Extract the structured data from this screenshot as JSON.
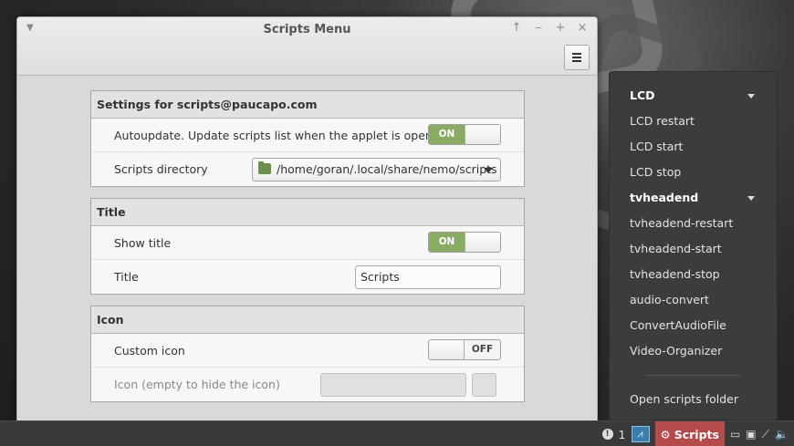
{
  "window": {
    "title": "Scripts Menu",
    "controls": {
      "up": "↑",
      "minimize": "–",
      "maximize": "+",
      "close": "×"
    }
  },
  "sections": {
    "settings": {
      "heading": "Settings for scripts@paucapo.com",
      "autoupdate_label": "Autoupdate. Update scripts list when the applet is opened.",
      "autoupdate_state": "ON",
      "scripts_dir_label": "Scripts directory",
      "scripts_dir_value": "/home/goran/.local/share/nemo/scripts"
    },
    "title": {
      "heading": "Title",
      "show_title_label": "Show title",
      "show_title_state": "ON",
      "title_label": "Title",
      "title_value": "Scripts"
    },
    "icon": {
      "heading": "Icon",
      "custom_icon_label": "Custom icon",
      "custom_icon_state": "OFF",
      "icon_field_label": "Icon (empty to hide the icon)",
      "icon_field_value": ""
    }
  },
  "popup": {
    "items": [
      {
        "label": "LCD",
        "type": "header"
      },
      {
        "label": "LCD restart",
        "type": "item"
      },
      {
        "label": "LCD start",
        "type": "item"
      },
      {
        "label": "LCD stop",
        "type": "item"
      },
      {
        "label": "tvheadend",
        "type": "header"
      },
      {
        "label": "tvheadend-restart",
        "type": "item"
      },
      {
        "label": "tvheadend-start",
        "type": "item"
      },
      {
        "label": "tvheadend-stop",
        "type": "item"
      },
      {
        "label": "audio-convert",
        "type": "item"
      },
      {
        "label": "ConvertAudioFile",
        "type": "item"
      },
      {
        "label": "Video-Organizer",
        "type": "item"
      }
    ],
    "footer": "Open scripts folder"
  },
  "panel": {
    "notification_count": "1",
    "scripts_label": "Scripts"
  },
  "colors": {
    "switch_on": "#8aab63",
    "scripts_applet": "#b44a4a",
    "popup_bg": "#3c3c3c"
  }
}
